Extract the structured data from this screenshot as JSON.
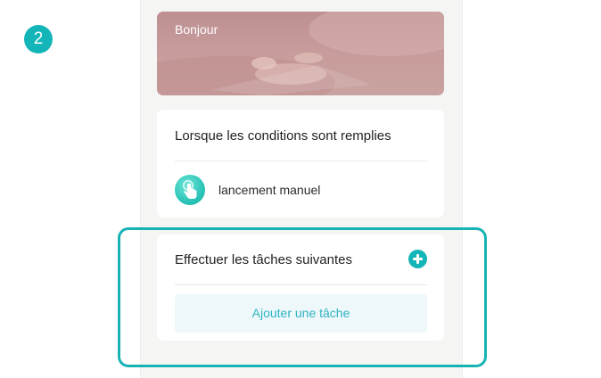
{
  "step_badge": "2",
  "banner": {
    "title": "Bonjour"
  },
  "conditions_card": {
    "title": "Lorsque les conditions sont remplies",
    "trigger": {
      "icon": "hand-tap-icon",
      "label": "lancement manuel"
    }
  },
  "tasks_card": {
    "title": "Effectuer les tâches suivantes",
    "add_icon": "plus-circle-icon",
    "add_task_label": "Ajouter une tâche"
  },
  "colors": {
    "accent": "#14b5b8",
    "highlight_frame": "#17b3b4",
    "add_task_bg": "#eef8fa",
    "add_task_text": "#2fb3c2",
    "panel_bg": "#f5f5f4",
    "banner": "#c49a9b"
  }
}
